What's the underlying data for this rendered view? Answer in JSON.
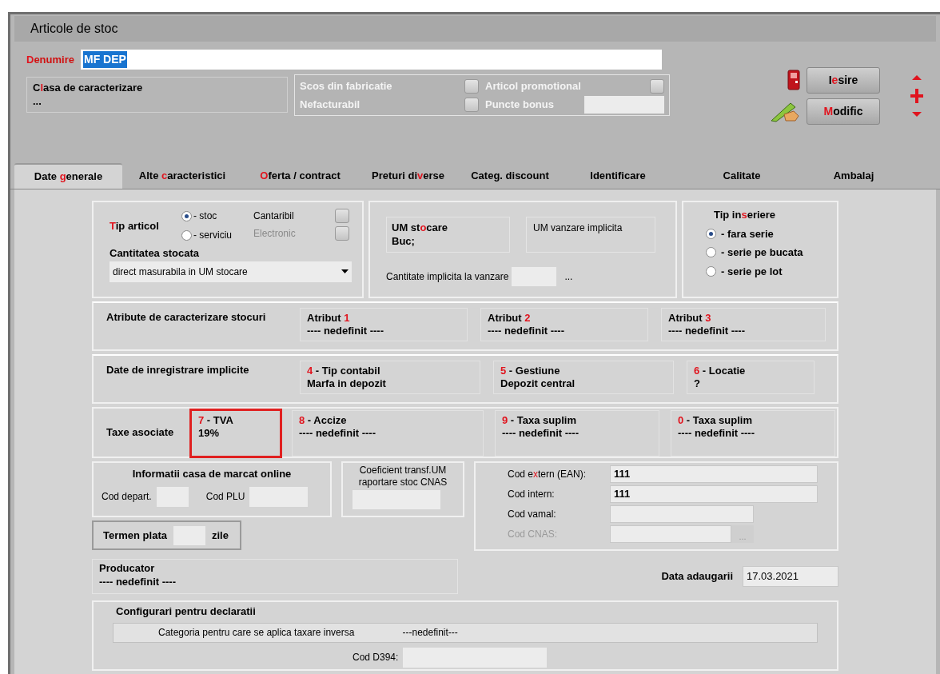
{
  "window": {
    "title": "Articole de stoc"
  },
  "denumire": {
    "label": {
      "hotkey": "D",
      "after": "enumire"
    },
    "value": "MF DEP"
  },
  "clasa": {
    "label": {
      "before": "C",
      "hotkey": "l",
      "after": "asa de caracterizare"
    },
    "value": "..."
  },
  "flags": [
    {
      "kind": "checkbox",
      "label": "Scos din fabricatie",
      "checked": false
    },
    {
      "kind": "checkbox",
      "label": "Articol promotional",
      "checked": false
    },
    {
      "kind": "checkbox",
      "label": "Nefacturabil",
      "checked": false
    },
    {
      "kind": "field",
      "label": "Puncte bonus"
    }
  ],
  "buttons": [
    {
      "kind": "exit",
      "label": {
        "before": "I",
        "hotkey": "e",
        "after": "sire"
      }
    },
    {
      "kind": "edit",
      "label": {
        "hotkey": "M",
        "after": "odific"
      }
    }
  ],
  "tabs": [
    {
      "label": {
        "before": "Date ",
        "hotkey": "g",
        "after": "enerale"
      },
      "selected": true
    },
    {
      "label": {
        "before": "Alte ",
        "hotkey": "c",
        "after": "aracteristici"
      },
      "selected": false
    },
    {
      "label": {
        "hotkey": "O",
        "after": "ferta / contract"
      },
      "selected": false
    },
    {
      "label": {
        "before": "Preturi di",
        "hotkey": "v",
        "after": "erse"
      },
      "selected": false
    },
    {
      "label": "Categ. discount",
      "selected": false
    },
    {
      "label": "Identificare",
      "selected": false
    },
    {
      "label": "Calitate",
      "selected": false
    },
    {
      "label": "Ambalaj",
      "selected": false
    }
  ],
  "tip_articol": {
    "label": {
      "hotkey": "T",
      "after": "ip articol"
    },
    "options": [
      {
        "label": "- stoc",
        "selected": true
      },
      {
        "label": "- serviciu",
        "selected": false
      }
    ],
    "flags": [
      {
        "label": "Cantaribil",
        "checked": false,
        "disabled": false
      },
      {
        "label": "Electronic",
        "checked": false,
        "disabled": true
      }
    ],
    "cantitate": {
      "label": "Cantitatea stocata",
      "value": "direct masurabila in UM stocare"
    }
  },
  "um": {
    "stocare": {
      "label": {
        "before": "UM st",
        "hotkey": "o",
        "after": "care"
      },
      "value": "Buc;"
    },
    "vanzare": {
      "label": "UM vanzare implicita"
    },
    "cantitate": {
      "label": "Cantitate implicita la vanzare",
      "more": "..."
    }
  },
  "tip_inseriere": {
    "label": {
      "before": "Tip in",
      "hotkey": "s",
      "after": "eriere"
    },
    "options": [
      {
        "label": "- fara serie",
        "selected": true
      },
      {
        "label": "- serie pe bucata",
        "selected": false
      },
      {
        "label": "- serie pe lot",
        "selected": false
      }
    ]
  },
  "atribute": {
    "label": "Atribute de caracterizare stocuri",
    "items": [
      {
        "label": {
          "before": "Atribut ",
          "hotkey": "1"
        },
        "value": "---- nedefinit ----",
        "highlighted": false
      },
      {
        "label": {
          "before": "Atribut ",
          "hotkey": "2"
        },
        "value": "---- nedefinit ----",
        "highlighted": false
      },
      {
        "label": {
          "before": "Atribut ",
          "hotkey": "3"
        },
        "value": "---- nedefinit ----",
        "highlighted": false
      }
    ]
  },
  "inregistrare": {
    "label": "Date de inregistrare implicite",
    "items": [
      {
        "label": {
          "hotkey": "4",
          "after": " - Tip contabil"
        },
        "value": "Marfa in depozit",
        "highlighted": false
      },
      {
        "label": {
          "hotkey": "5",
          "after": " - Gestiune"
        },
        "value": "Depozit central",
        "highlighted": false
      },
      {
        "label": {
          "hotkey": "6",
          "after": " - Locatie"
        },
        "value": "?",
        "highlighted": false
      }
    ]
  },
  "taxe": {
    "label": "Taxe asociate",
    "items": [
      {
        "label": {
          "hotkey": "7",
          "after": " - TVA"
        },
        "value": "19%",
        "highlighted": true
      },
      {
        "label": {
          "hotkey": "8",
          "after": " - Accize"
        },
        "value": "---- nedefinit ----",
        "highlighted": false
      },
      {
        "label": {
          "hotkey": "9",
          "after": " - Taxa suplim"
        },
        "value": "---- nedefinit ----",
        "highlighted": false
      },
      {
        "label": {
          "hotkey": "0",
          "after": " - Taxa suplim"
        },
        "value": "---- nedefinit ----",
        "highlighted": false
      }
    ]
  },
  "casa_marcat": {
    "title": "Informatii casa de marcat online",
    "fields": [
      {
        "label": "Cod depart."
      },
      {
        "label": "Cod PLU"
      }
    ]
  },
  "coeficient": {
    "label": "Coeficient transf.UM raportare stoc CNAS"
  },
  "coduri": [
    {
      "label": {
        "before": "Cod e",
        "hotkey": "x",
        "after": "tern (EAN):"
      },
      "value": "111",
      "disabled": false
    },
    {
      "label": "Cod intern:",
      "value": "111",
      "disabled": false
    },
    {
      "label": "Cod vamal:",
      "disabled": false
    },
    {
      "label": "Cod CNAS:",
      "disabled": true,
      "more": "..."
    }
  ],
  "termen_plata": {
    "label": "Termen plata",
    "unit": "zile"
  },
  "producator": {
    "label": "Producator",
    "value": "---- nedefinit ----"
  },
  "data_adaugarii": {
    "label": "Data adaugarii",
    "value": "17.03.2021"
  },
  "declaratii": {
    "title": "Configurari pentru declaratii",
    "categorie": {
      "label": "Categoria pentru care se aplica taxare inversa",
      "value": "---nedefinit---"
    },
    "cod_d394": {
      "label": "Cod D394:"
    }
  }
}
